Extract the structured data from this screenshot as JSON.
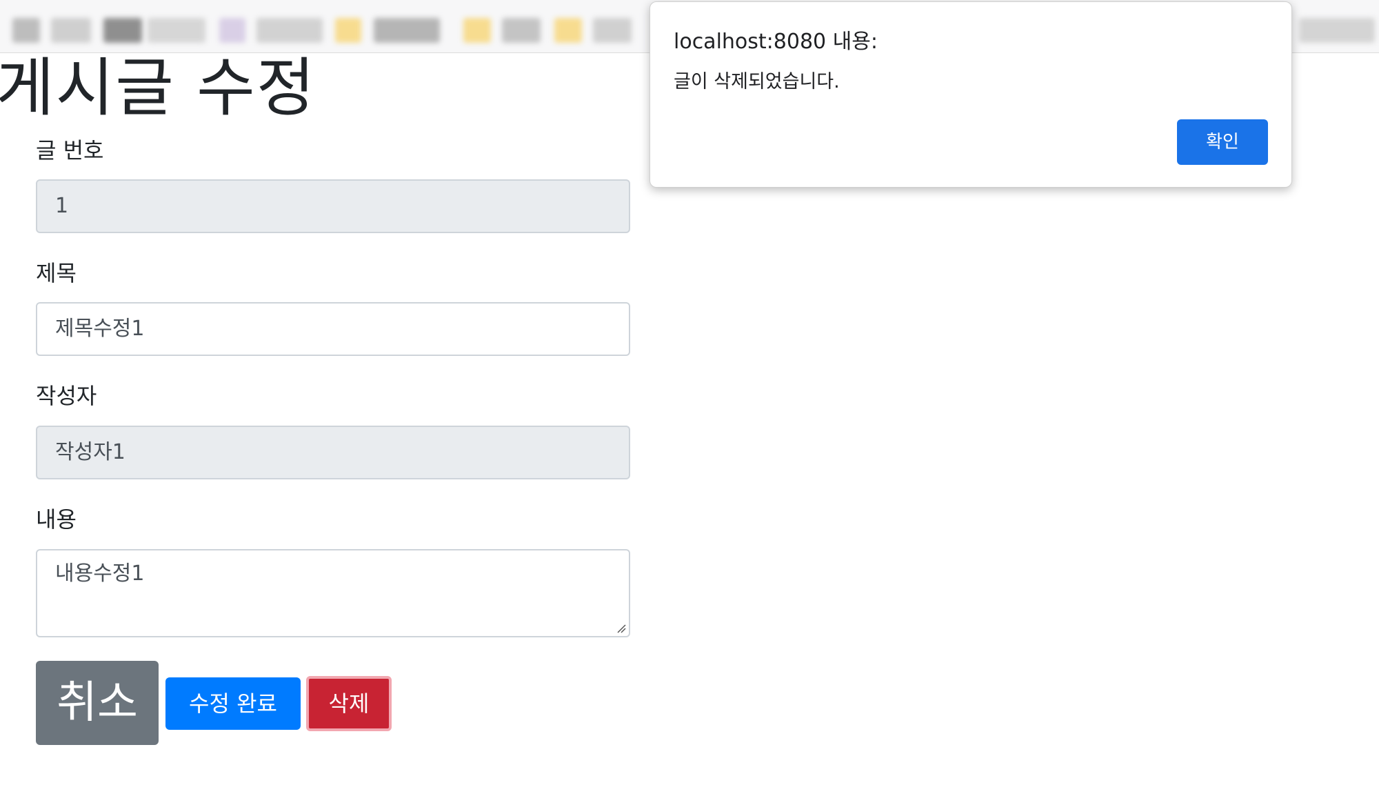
{
  "page": {
    "title": "게시글 수정"
  },
  "form": {
    "number": {
      "label": "글 번호",
      "value": "1"
    },
    "title": {
      "label": "제목",
      "value": "제목수정1"
    },
    "author": {
      "label": "작성자",
      "value": "작성자1"
    },
    "content": {
      "label": "내용",
      "value": "내용수정1"
    }
  },
  "buttons": {
    "cancel": "취소",
    "submit": "수정 완료",
    "delete": "삭제"
  },
  "dialog": {
    "title": "localhost:8080 내용:",
    "message": "글이 삭제되었습니다.",
    "ok": "확인"
  },
  "colors": {
    "primary": "#007bff",
    "secondary": "#6c757d",
    "danger": "#c82333",
    "dialog_button": "#1a73e8",
    "readonly_bg": "#e9ecef"
  }
}
